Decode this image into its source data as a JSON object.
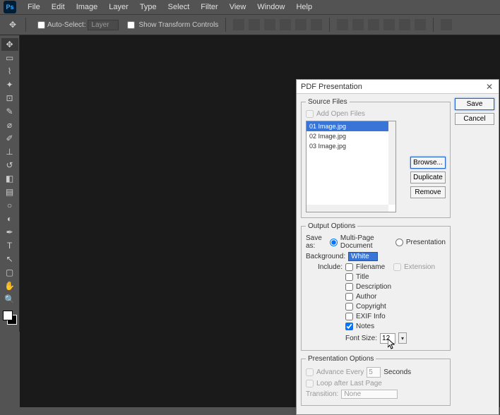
{
  "app": {
    "logo": "Ps"
  },
  "menu": [
    "File",
    "Edit",
    "Image",
    "Layer",
    "Type",
    "Select",
    "Filter",
    "View",
    "Window",
    "Help"
  ],
  "options": {
    "auto_select": "Auto-Select:",
    "layer": "Layer",
    "show_transform": "Show Transform Controls"
  },
  "dialog": {
    "title": "PDF Presentation",
    "save": "Save",
    "cancel": "Cancel",
    "source": {
      "legend": "Source Files",
      "add_open": "Add Open Files",
      "files": [
        "01 Image.jpg",
        "02 Image.jpg",
        "03 Image.jpg"
      ],
      "browse": "Browse...",
      "duplicate": "Duplicate",
      "remove": "Remove"
    },
    "output": {
      "legend": "Output Options",
      "save_as": "Save as:",
      "multi_page": "Multi-Page Document",
      "presentation": "Presentation",
      "background": "Background:",
      "bg_value": "White",
      "include": "Include:",
      "filename": "Filename",
      "extension": "Extension",
      "title": "Title",
      "description": "Description",
      "author": "Author",
      "copyright": "Copyright",
      "exif": "EXIF Info",
      "notes": "Notes",
      "font_size": "Font Size:",
      "font_size_value": "12"
    },
    "pres": {
      "legend": "Presentation Options",
      "advance": "Advance Every",
      "adv_value": "5",
      "seconds": "Seconds",
      "loop": "Loop after Last Page",
      "transition": "Transition:",
      "trans_value": "None"
    }
  }
}
